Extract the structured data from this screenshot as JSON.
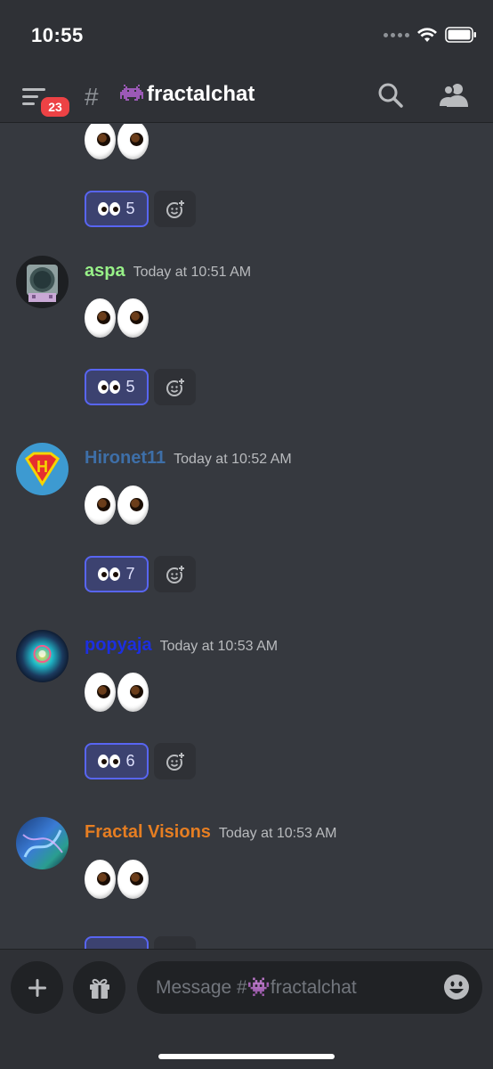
{
  "status_bar": {
    "time": "10:55"
  },
  "header": {
    "badge_count": "23",
    "channel_prefix": "#",
    "channel_name": "fractalchat",
    "channel_emoji": "👾"
  },
  "messages": [
    {
      "author": "",
      "timestamp": "",
      "emoji": "👀",
      "reaction_count": "5",
      "author_color": "#ffffff"
    },
    {
      "author": "aspa",
      "timestamp": "Today at 10:51 AM",
      "emoji": "👀",
      "reaction_count": "5",
      "author_color": "#98f188"
    },
    {
      "author": "Hironet11",
      "timestamp": "Today at 10:52 AM",
      "emoji": "👀",
      "reaction_count": "7",
      "author_color": "#3e6fa8"
    },
    {
      "author": "popyaja",
      "timestamp": "Today at 10:53 AM",
      "emoji": "👀",
      "reaction_count": "6",
      "author_color": "#1c2fe0"
    },
    {
      "author": "Fractal Visions",
      "timestamp": "Today at 10:53 AM",
      "emoji": "👀",
      "reaction_count": "",
      "author_color": "#e67e22"
    }
  ],
  "composer": {
    "placeholder": "Message #👾fractalchat"
  },
  "colors": {
    "background": "#36393f",
    "header": "#2f3136",
    "accent": "#5865f2",
    "badge": "#ed4245"
  }
}
